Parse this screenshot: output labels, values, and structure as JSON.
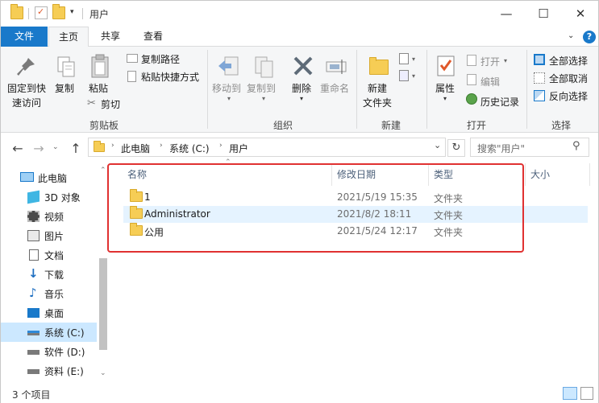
{
  "window": {
    "title": "用户",
    "controls": {
      "minimize": "—",
      "maximize": "☐",
      "close": "✕"
    }
  },
  "ribbon_tabs": [
    "文件",
    "主页",
    "共享",
    "查看"
  ],
  "ribbon": {
    "clipboard": {
      "pin_line1": "固定到快",
      "pin_line2": "速访问",
      "copy": "复制",
      "paste": "粘贴",
      "copy_path": "复制路径",
      "paste_shortcut": "粘贴快捷方式",
      "cut": "剪切",
      "group": "剪贴板"
    },
    "organize": {
      "move_to": "移动到",
      "copy_to": "复制到",
      "delete": "删除",
      "rename": "重命名",
      "group": "组织"
    },
    "new": {
      "new_folder_line1": "新建",
      "new_folder_line2": "文件夹",
      "group": "新建"
    },
    "open": {
      "properties": "属性",
      "open": "打开",
      "edit": "编辑",
      "history": "历史记录",
      "group": "打开"
    },
    "select": {
      "select_all": "全部选择",
      "select_none": "全部取消",
      "invert": "反向选择",
      "group": "选择"
    }
  },
  "address": {
    "crumbs": [
      "此电脑",
      "系统 (C:)",
      "用户"
    ],
    "search_placeholder": "搜索\"用户\""
  },
  "nav_pane": [
    {
      "label": "此电脑",
      "icon": "computer-icon"
    },
    {
      "label": "3D 对象",
      "icon": "3d-objects-icon"
    },
    {
      "label": "视频",
      "icon": "video-icon"
    },
    {
      "label": "图片",
      "icon": "picture-icon"
    },
    {
      "label": "文档",
      "icon": "document-icon"
    },
    {
      "label": "下载",
      "icon": "download-icon"
    },
    {
      "label": "音乐",
      "icon": "music-icon"
    },
    {
      "label": "桌面",
      "icon": "desktop-icon"
    },
    {
      "label": "系统 (C:)",
      "icon": "drive-icon",
      "selected": true
    },
    {
      "label": "软件 (D:)",
      "icon": "drive-icon"
    },
    {
      "label": "资料 (E:)",
      "icon": "drive-icon"
    }
  ],
  "columns": [
    "名称",
    "修改日期",
    "类型",
    "大小"
  ],
  "files": [
    {
      "name": "1",
      "modified": "2021/5/19 15:35",
      "type": "文件夹"
    },
    {
      "name": "Administrator",
      "modified": "2021/8/2 18:11",
      "type": "文件夹"
    },
    {
      "name": "公用",
      "modified": "2021/5/24 12:17",
      "type": "文件夹"
    }
  ],
  "status": {
    "item_count": "3 个项目"
  },
  "colors": {
    "accent": "#1979ca",
    "highlight_box": "#e03131",
    "folder": "#f6cd55"
  }
}
